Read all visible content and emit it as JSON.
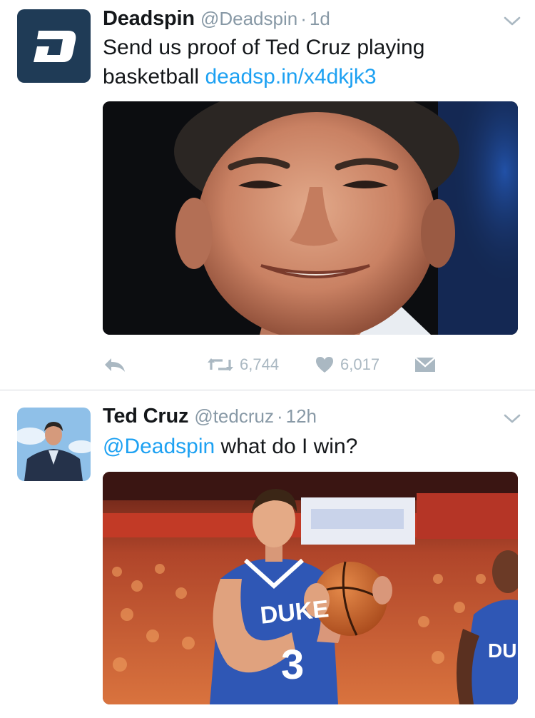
{
  "tweets": [
    {
      "name": "Deadspin",
      "handle": "@Deadspin",
      "separator": "·",
      "time": "1d",
      "text_plain": "Send us proof of Ted Cruz playing basketball ",
      "text_link": "deadsp.in/x4dkjk3",
      "retweet_count": "6,744",
      "like_count": "6,017",
      "avatar_letter": "D"
    },
    {
      "name": "Ted Cruz",
      "handle": "@tedcruz",
      "separator": "·",
      "time": "12h",
      "text_mention": "@Deadspin",
      "text_plain": " what do I win?",
      "jersey_text": "DUKE",
      "jersey_number": "3",
      "jersey_text_2": "DU"
    }
  ],
  "colors": {
    "link": "#1da1f2",
    "meta_gray": "#8899a6",
    "action_gray": "#aab8c2",
    "deadspin_avatar_bg": "#1f3b56"
  },
  "icons": [
    "chevron-down-icon",
    "reply-icon",
    "retweet-icon",
    "heart-icon",
    "direct-message-icon"
  ]
}
